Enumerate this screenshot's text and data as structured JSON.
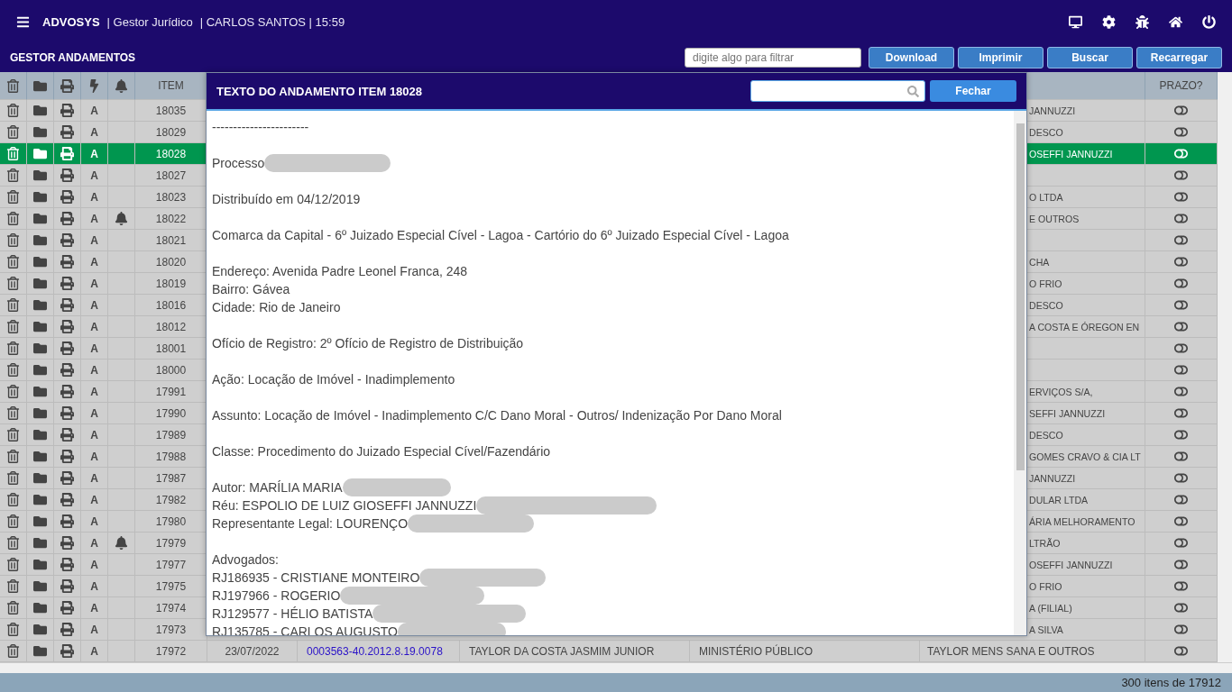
{
  "topbar": {
    "brand": "ADVOSYS",
    "subtitle": "| Gestor Jurídico",
    "user": "| CARLOS SANTOS | 15:59"
  },
  "toolbar": {
    "title": "GESTOR ANDAMENTOS",
    "filter": {
      "placeholder": "digite algo para filtrar"
    },
    "buttons": [
      "Download",
      "Imprimir",
      "Buscar",
      "Recarregar"
    ]
  },
  "table": {
    "columns": {
      "item": "ITEM",
      "prazo": "PRAZO?"
    },
    "rows": [
      {
        "item": "18035",
        "action": "A",
        "bell": false,
        "selected": false,
        "party": "JANNUZZI"
      },
      {
        "item": "18029",
        "action": "A",
        "bell": false,
        "selected": false,
        "party": "DESCO"
      },
      {
        "item": "18028",
        "action": "A",
        "bell": false,
        "selected": true,
        "party": "OSEFFI JANNUZZI"
      },
      {
        "item": "18027",
        "action": "A",
        "bell": false,
        "selected": false
      },
      {
        "item": "18023",
        "action": "A",
        "bell": false,
        "selected": false,
        "party": "O LTDA"
      },
      {
        "item": "18022",
        "action": "A",
        "bell": true,
        "selected": false,
        "party": "E OUTROS"
      },
      {
        "item": "18021",
        "action": "A",
        "bell": false,
        "selected": false
      },
      {
        "item": "18020",
        "action": "A",
        "bell": false,
        "selected": false,
        "party": "CHA"
      },
      {
        "item": "18019",
        "action": "A",
        "bell": false,
        "selected": false,
        "party": "O FRIO"
      },
      {
        "item": "18016",
        "action": "A",
        "bell": false,
        "selected": false,
        "party": "DESCO"
      },
      {
        "item": "18012",
        "action": "A",
        "bell": false,
        "selected": false,
        "party": "A COSTA E ÓREGON EN"
      },
      {
        "item": "18001",
        "action": "A",
        "bell": false,
        "selected": false
      },
      {
        "item": "18000",
        "action": "A",
        "bell": false,
        "selected": false
      },
      {
        "item": "17991",
        "action": "A",
        "bell": false,
        "selected": false,
        "party": "ERVIÇOS S/A,"
      },
      {
        "item": "17990",
        "action": "A",
        "bell": false,
        "selected": false,
        "party": "SEFFI JANNUZZI"
      },
      {
        "item": "17989",
        "action": "A",
        "bell": false,
        "selected": false,
        "party": "DESCO"
      },
      {
        "item": "17988",
        "action": "A",
        "bell": false,
        "selected": false,
        "party": "GOMES CRAVO & CIA LT"
      },
      {
        "item": "17987",
        "action": "A",
        "bell": false,
        "selected": false,
        "party": "JANNUZZI"
      },
      {
        "item": "17982",
        "action": "A",
        "bell": false,
        "selected": false,
        "party": "DULAR LTDA"
      },
      {
        "item": "17980",
        "action": "A",
        "bell": false,
        "selected": false,
        "party": "ÁRIA MELHORAMENTO"
      },
      {
        "item": "17979",
        "action": "A",
        "bell": true,
        "selected": false,
        "party": "LTRÃO"
      },
      {
        "item": "17977",
        "action": "A",
        "bell": false,
        "selected": false,
        "party": "OSEFFI JANNUZZI"
      },
      {
        "item": "17975",
        "action": "A",
        "bell": false,
        "selected": false,
        "party": "O FRIO"
      },
      {
        "item": "17974",
        "action": "A",
        "bell": false,
        "selected": false,
        "party": "A (FILIAL)"
      },
      {
        "item": "17973",
        "action": "A",
        "bell": false,
        "selected": false,
        "party": "A SILVA"
      },
      {
        "item": "17972",
        "action": "A",
        "bell": false,
        "selected": false,
        "date": "23/07/2022",
        "process": "0003563-40.2012.8.19.0078",
        "author": "TAYLOR DA COSTA JASMIM JUNIOR",
        "defendant": "MINISTÉRIO PÚBLICO",
        "party": "TAYLOR MENS SANA E OUTROS"
      }
    ]
  },
  "modal": {
    "title": "TEXTO DO ANDAMENTO ITEM 18028",
    "close": "Fechar",
    "paragraphs": [
      {
        "kind": "paragraph",
        "lines": [
          {
            "text": "-----------------------",
            "redacted": false
          }
        ]
      },
      {
        "kind": "paragraph",
        "lines": [
          {
            "text": "Processo",
            "redacted": true
          }
        ]
      },
      {
        "kind": "paragraph",
        "lines": [
          {
            "text": "Distribuído em 04/12/2019",
            "redacted": false
          }
        ]
      },
      {
        "kind": "paragraph",
        "lines": [
          {
            "text": "Comarca da Capital  -  6º Juizado Especial Cível - Lagoa - Cartório do 6º Juizado Especial Cível - Lagoa",
            "redacted": false
          }
        ]
      },
      {
        "kind": "paragraph",
        "lines": [
          {
            "text": "Endereço: Avenida Padre Leonel Franca, 248",
            "redacted": false
          },
          {
            "text": "Bairro: Gávea",
            "redacted": false
          },
          {
            "text": "Cidade: Rio de Janeiro",
            "redacted": false
          }
        ]
      },
      {
        "kind": "paragraph",
        "lines": [
          {
            "text": "Ofício de Registro: 2º Ofício de Registro de Distribuição",
            "redacted": false
          }
        ]
      },
      {
        "kind": "paragraph",
        "lines": [
          {
            "text": "Ação: Locação de Imóvel - Inadimplemento",
            "redacted": false
          }
        ]
      },
      {
        "kind": "paragraph",
        "lines": [
          {
            "text": "Assunto: Locação de Imóvel - Inadimplemento C/C Dano Moral - Outros/ Indenização Por Dano Moral",
            "redacted": false
          }
        ]
      },
      {
        "kind": "paragraph",
        "lines": [
          {
            "text": "Classe: Procedimento do Juizado Especial Cível/Fazendário",
            "redacted": false
          }
        ]
      },
      {
        "kind": "paragraph",
        "lines": [
          {
            "text": "Autor: MARÍLIA MARIA",
            "redacted": true
          },
          {
            "text": "Réu: ESPOLIO DE LUIZ GIOSEFFI JANNUZZI",
            "redacted": true
          },
          {
            "text": "Representante Legal: LOURENÇO",
            "redacted": true
          }
        ]
      },
      {
        "kind": "section",
        "lines": [
          {
            "text": "Advogados:",
            "redacted": false
          },
          {
            "text": "RJ186935 - CRISTIANE MONTEIRO",
            "redacted": true
          },
          {
            "text": "RJ197966 - ROGERIO",
            "redacted": true
          },
          {
            "text": "RJ129577 - HÉLIO BATISTA",
            "redacted": true
          },
          {
            "text": "RJ135785 - CARLOS AUGUSTO",
            "redacted": true
          }
        ]
      }
    ]
  },
  "status_bar": "300 itens de 17912"
}
